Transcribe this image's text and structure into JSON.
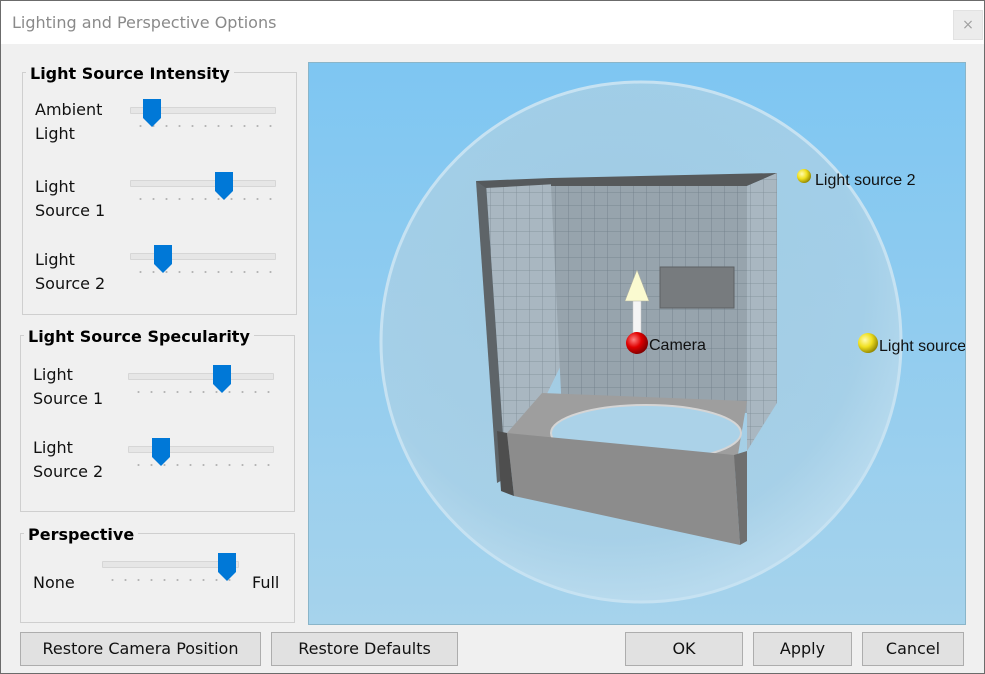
{
  "window": {
    "title": "Lighting and Perspective Options",
    "close_glyph": "×"
  },
  "intensity": {
    "legend": "Light Source Intensity",
    "ambient": {
      "line1": "Ambient",
      "line2": "Light",
      "level": 0.08
    },
    "source1": {
      "line1": "Light",
      "line2": "Source 1",
      "level": 0.67
    },
    "source2": {
      "line1": "Light",
      "line2": "Source 2",
      "level": 0.17
    }
  },
  "specularity": {
    "legend": "Light Source Specularity",
    "source1": {
      "line1": "Light",
      "line2": "Source 1",
      "level": 0.67
    },
    "source2": {
      "line1": "Light",
      "line2": "Source 2",
      "level": 0.17
    }
  },
  "perspective": {
    "legend": "Perspective",
    "min_label": "None",
    "max_label": "Full",
    "level": 1.0
  },
  "viewport": {
    "labels": {
      "light_source_2": "Light source 2",
      "light_source_1": "Light source",
      "camera": "Camera"
    },
    "colors": {
      "sky_top": "#7ec6f2",
      "sky_bottom": "#a6d3ec",
      "camera_sphere": "#e00000",
      "light_sphere": "#f0e020"
    }
  },
  "buttons": {
    "restore_camera": "Restore Camera Position",
    "restore_defaults": "Restore Defaults",
    "ok": "OK",
    "apply": "Apply",
    "cancel": "Cancel"
  },
  "colors": {
    "slider_thumb": "#0078d7"
  }
}
